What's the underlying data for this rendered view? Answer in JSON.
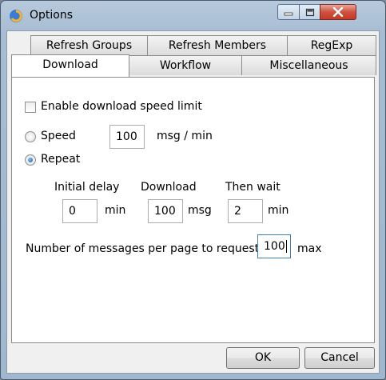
{
  "window": {
    "title": "Options"
  },
  "tabs": {
    "row_top": [
      "Refresh Groups",
      "Refresh Members",
      "RegExp"
    ],
    "row_bottom": [
      "Download",
      "Workflow",
      "Miscellaneous"
    ],
    "active": "Download"
  },
  "download": {
    "speed_limit_checkbox": {
      "label": "Enable download speed limit",
      "checked": false
    },
    "speed_option": {
      "label": "Speed",
      "selected": false,
      "value": "100",
      "unit": "msg / min"
    },
    "repeat_option": {
      "label": "Repeat",
      "selected": true
    },
    "initial_delay": {
      "label": "Initial delay",
      "value": "0",
      "unit": "min"
    },
    "download_count": {
      "label": "Download",
      "value": "100",
      "unit": "msg"
    },
    "then_wait": {
      "label": "Then wait",
      "value": "2",
      "unit": "min"
    },
    "per_page": {
      "label": "Number of messages per page to request",
      "value": "100",
      "unit": "max"
    }
  },
  "buttons": {
    "ok": "OK",
    "cancel": "Cancel"
  },
  "colors": {
    "focus_border": "#3c7fb1",
    "close_button": "#c43a24",
    "title_bar": "#b7c9dc"
  }
}
